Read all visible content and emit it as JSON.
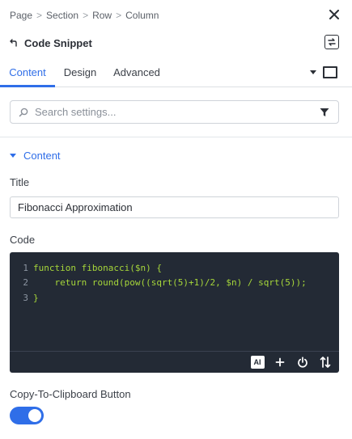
{
  "breadcrumb": [
    "Page",
    "Section",
    "Row",
    "Column"
  ],
  "breadcrumb_separator": ">",
  "panel": {
    "title": "Code Snippet"
  },
  "tabs": [
    {
      "label": "Content",
      "active": true
    },
    {
      "label": "Design",
      "active": false
    },
    {
      "label": "Advanced",
      "active": false
    }
  ],
  "search": {
    "placeholder": "Search settings...",
    "value": ""
  },
  "section": {
    "label": "Content",
    "expanded": true
  },
  "fields": {
    "title": {
      "label": "Title",
      "value": "Fibonacci Approximation"
    },
    "code": {
      "label": "Code",
      "lines": [
        {
          "num": "1",
          "text": "function fibonacci($n) {"
        },
        {
          "num": "2",
          "text": "    return round(pow((sqrt(5)+1)/2, $n) / sqrt(5));"
        },
        {
          "num": "3",
          "text": "}"
        }
      ],
      "toolbar": {
        "ai_label": "AI"
      }
    },
    "copy_button": {
      "label": "Copy-To-Clipboard Button",
      "enabled": true
    }
  },
  "colors": {
    "accent": "#2f6ee8",
    "editor_bg": "#232a35",
    "code_text": "#a6d63a"
  },
  "icons": [
    "close-icon",
    "back-arrow-icon",
    "swap-icon",
    "caret-down-icon",
    "square-icon",
    "search-icon",
    "filter-icon",
    "plus-icon",
    "power-icon",
    "sort-icon"
  ]
}
